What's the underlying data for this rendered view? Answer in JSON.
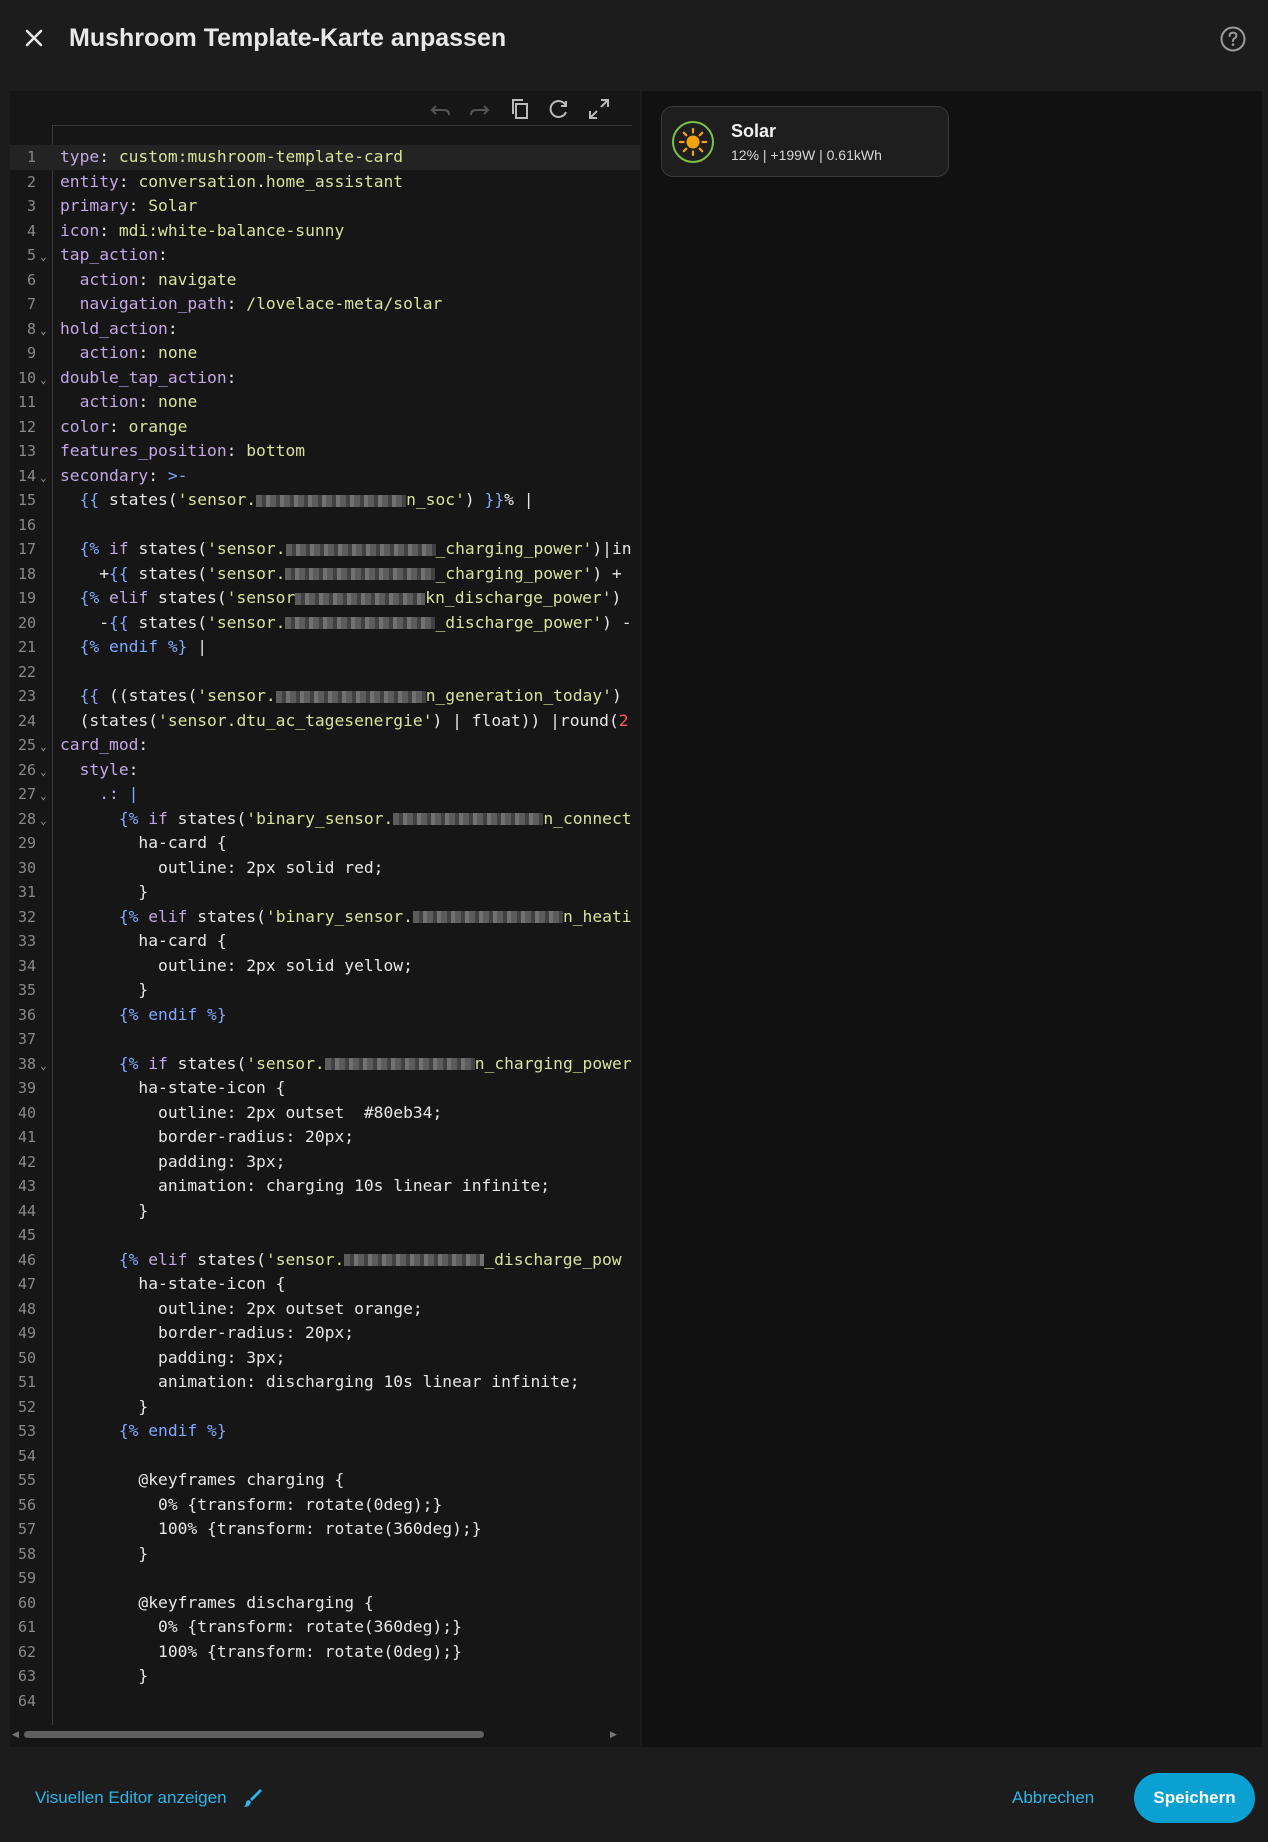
{
  "dialog": {
    "title": "Mushroom Template-Karte anpassen",
    "close_icon": "close-icon",
    "help_icon": "help-circle-icon"
  },
  "toolbar": {
    "icons": [
      "undo-icon",
      "redo-icon",
      "copy-icon",
      "refresh-icon",
      "fullscreen-icon"
    ]
  },
  "editor": {
    "lines": [
      {
        "n": "1",
        "fold": ""
      },
      {
        "n": "2",
        "fold": ""
      },
      {
        "n": "3",
        "fold": ""
      },
      {
        "n": "4",
        "fold": ""
      },
      {
        "n": "5",
        "fold": "v"
      },
      {
        "n": "6",
        "fold": ""
      },
      {
        "n": "7",
        "fold": ""
      },
      {
        "n": "8",
        "fold": "v"
      },
      {
        "n": "9",
        "fold": ""
      },
      {
        "n": "10",
        "fold": "v"
      },
      {
        "n": "11",
        "fold": ""
      },
      {
        "n": "12",
        "fold": ""
      },
      {
        "n": "13",
        "fold": ""
      },
      {
        "n": "14",
        "fold": "v"
      },
      {
        "n": "15",
        "fold": ""
      },
      {
        "n": "16",
        "fold": ""
      },
      {
        "n": "17",
        "fold": ""
      },
      {
        "n": "18",
        "fold": ""
      },
      {
        "n": "19",
        "fold": ""
      },
      {
        "n": "20",
        "fold": ""
      },
      {
        "n": "21",
        "fold": ""
      },
      {
        "n": "22",
        "fold": ""
      },
      {
        "n": "23",
        "fold": ""
      },
      {
        "n": "24",
        "fold": ""
      },
      {
        "n": "25",
        "fold": "v"
      },
      {
        "n": "26",
        "fold": "v"
      },
      {
        "n": "27",
        "fold": "v"
      },
      {
        "n": "28",
        "fold": "v"
      },
      {
        "n": "29",
        "fold": ""
      },
      {
        "n": "30",
        "fold": ""
      },
      {
        "n": "31",
        "fold": ""
      },
      {
        "n": "32",
        "fold": ""
      },
      {
        "n": "33",
        "fold": ""
      },
      {
        "n": "34",
        "fold": ""
      },
      {
        "n": "35",
        "fold": ""
      },
      {
        "n": "36",
        "fold": ""
      },
      {
        "n": "37",
        "fold": ""
      },
      {
        "n": "38",
        "fold": "v"
      },
      {
        "n": "39",
        "fold": ""
      },
      {
        "n": "40",
        "fold": ""
      },
      {
        "n": "41",
        "fold": ""
      },
      {
        "n": "42",
        "fold": ""
      },
      {
        "n": "43",
        "fold": ""
      },
      {
        "n": "44",
        "fold": ""
      },
      {
        "n": "45",
        "fold": ""
      },
      {
        "n": "46",
        "fold": ""
      },
      {
        "n": "47",
        "fold": ""
      },
      {
        "n": "48",
        "fold": ""
      },
      {
        "n": "49",
        "fold": ""
      },
      {
        "n": "50",
        "fold": ""
      },
      {
        "n": "51",
        "fold": ""
      },
      {
        "n": "52",
        "fold": ""
      },
      {
        "n": "53",
        "fold": ""
      },
      {
        "n": "54",
        "fold": ""
      },
      {
        "n": "55",
        "fold": ""
      },
      {
        "n": "56",
        "fold": ""
      },
      {
        "n": "57",
        "fold": ""
      },
      {
        "n": "58",
        "fold": ""
      },
      {
        "n": "59",
        "fold": ""
      },
      {
        "n": "60",
        "fold": ""
      },
      {
        "n": "61",
        "fold": ""
      },
      {
        "n": "62",
        "fold": ""
      },
      {
        "n": "63",
        "fold": ""
      },
      {
        "n": "64",
        "fold": ""
      }
    ],
    "code": [
      [
        [
          "k",
          "type"
        ],
        [
          "p",
          ": "
        ],
        [
          "s",
          "custom:mushroom-template-card"
        ]
      ],
      [
        [
          "k",
          "entity"
        ],
        [
          "p",
          ": "
        ],
        [
          "s",
          "conversation.home_assistant"
        ]
      ],
      [
        [
          "k",
          "primary"
        ],
        [
          "p",
          ": "
        ],
        [
          "s",
          "Solar"
        ]
      ],
      [
        [
          "k",
          "icon"
        ],
        [
          "p",
          ": "
        ],
        [
          "s",
          "mdi:white-balance-sunny"
        ]
      ],
      [
        [
          "k",
          "tap_action"
        ],
        [
          "p",
          ":"
        ]
      ],
      [
        [
          "p",
          "  "
        ],
        [
          "k",
          "action"
        ],
        [
          "p",
          ": "
        ],
        [
          "s",
          "navigate"
        ]
      ],
      [
        [
          "p",
          "  "
        ],
        [
          "k",
          "navigation_path"
        ],
        [
          "p",
          ": "
        ],
        [
          "s",
          "/lovelace-meta/solar"
        ]
      ],
      [
        [
          "k",
          "hold_action"
        ],
        [
          "p",
          ":"
        ]
      ],
      [
        [
          "p",
          "  "
        ],
        [
          "k",
          "action"
        ],
        [
          "p",
          ": "
        ],
        [
          "s",
          "none"
        ]
      ],
      [
        [
          "k",
          "double_tap_action"
        ],
        [
          "p",
          ":"
        ]
      ],
      [
        [
          "p",
          "  "
        ],
        [
          "k",
          "action"
        ],
        [
          "p",
          ": "
        ],
        [
          "s",
          "none"
        ]
      ],
      [
        [
          "k",
          "color"
        ],
        [
          "p",
          ": "
        ],
        [
          "s",
          "orange"
        ]
      ],
      [
        [
          "k",
          "features_position"
        ],
        [
          "p",
          ": "
        ],
        [
          "s",
          "bottom"
        ]
      ],
      [
        [
          "k",
          "secondary"
        ],
        [
          "p",
          ": "
        ],
        [
          "d",
          ">-"
        ]
      ],
      [
        [
          "p",
          "  "
        ],
        [
          "d",
          "{{ "
        ],
        [
          "p",
          "states("
        ],
        [
          "sq",
          "'sensor."
        ],
        [
          "b",
          "150"
        ],
        [
          "sq",
          "n_soc'"
        ],
        [
          "p",
          ") "
        ],
        [
          "d",
          "}}"
        ],
        [
          "p",
          "% |"
        ]
      ],
      [],
      [
        [
          "p",
          "  "
        ],
        [
          "d",
          "{% "
        ],
        [
          "k",
          "if "
        ],
        [
          "p",
          "states("
        ],
        [
          "sq",
          "'sensor."
        ],
        [
          "b",
          "150"
        ],
        [
          "sq",
          "_charging_power'"
        ],
        [
          "p",
          ")|in"
        ]
      ],
      [
        [
          "p",
          "    +"
        ],
        [
          "d",
          "{{ "
        ],
        [
          "p",
          "states("
        ],
        [
          "sq",
          "'sensor."
        ],
        [
          "b",
          "150"
        ],
        [
          "sq",
          "_charging_power'"
        ],
        [
          "p",
          ") +"
        ]
      ],
      [
        [
          "p",
          "  "
        ],
        [
          "d",
          "{% "
        ],
        [
          "k",
          "elif "
        ],
        [
          "p",
          "states("
        ],
        [
          "sq",
          "'sensor"
        ],
        [
          "b",
          "130"
        ],
        [
          "sq",
          "kn_discharge_power'"
        ],
        [
          "p",
          ")"
        ]
      ],
      [
        [
          "p",
          "    -"
        ],
        [
          "d",
          "{{ "
        ],
        [
          "p",
          "states("
        ],
        [
          "sq",
          "'sensor."
        ],
        [
          "b",
          "150"
        ],
        [
          "sq",
          "_discharge_power'"
        ],
        [
          "p",
          ") -"
        ]
      ],
      [
        [
          "p",
          "  "
        ],
        [
          "d",
          "{% endif %}"
        ],
        [
          "p",
          " |"
        ]
      ],
      [],
      [
        [
          "p",
          "  "
        ],
        [
          "d",
          "{{ "
        ],
        [
          "p",
          "((states("
        ],
        [
          "sq",
          "'sensor."
        ],
        [
          "b",
          "150"
        ],
        [
          "sq",
          "n_generation_today'"
        ],
        [
          "p",
          ")"
        ]
      ],
      [
        [
          "p",
          "  (states("
        ],
        [
          "sq",
          "'sensor.dtu_ac_tagesenergie'"
        ],
        [
          "p",
          ") | float)) |round("
        ],
        [
          "r",
          "2"
        ]
      ],
      [
        [
          "k",
          "card_mod"
        ],
        [
          "p",
          ":"
        ]
      ],
      [
        [
          "p",
          "  "
        ],
        [
          "k",
          "style"
        ],
        [
          "p",
          ":"
        ]
      ],
      [
        [
          "p",
          "    "
        ],
        [
          "k",
          ".:"
        ],
        [
          "p",
          " "
        ],
        [
          "d",
          "|"
        ]
      ],
      [
        [
          "p",
          "      "
        ],
        [
          "d",
          "{% "
        ],
        [
          "k",
          "if "
        ],
        [
          "p",
          "states("
        ],
        [
          "sq",
          "'binary_sensor."
        ],
        [
          "b",
          "150"
        ],
        [
          "sq",
          "n_connecti"
        ]
      ],
      [
        [
          "p",
          "        ha-card {"
        ]
      ],
      [
        [
          "p",
          "          outline: 2px solid red;"
        ]
      ],
      [
        [
          "p",
          "        }"
        ]
      ],
      [
        [
          "p",
          "      "
        ],
        [
          "d",
          "{% "
        ],
        [
          "k",
          "elif "
        ],
        [
          "p",
          "states("
        ],
        [
          "sq",
          "'binary_sensor."
        ],
        [
          "b",
          "150"
        ],
        [
          "sq",
          "n_heatin"
        ]
      ],
      [
        [
          "p",
          "        ha-card {"
        ]
      ],
      [
        [
          "p",
          "          outline: 2px solid yellow;"
        ]
      ],
      [
        [
          "p",
          "        }"
        ]
      ],
      [
        [
          "p",
          "      "
        ],
        [
          "d",
          "{% endif %}"
        ]
      ],
      [],
      [
        [
          "p",
          "      "
        ],
        [
          "d",
          "{% "
        ],
        [
          "k",
          "if "
        ],
        [
          "p",
          "states("
        ],
        [
          "sq",
          "'sensor."
        ],
        [
          "b",
          "150"
        ],
        [
          "sq",
          "n_charging_power"
        ]
      ],
      [
        [
          "p",
          "        ha-state-icon {"
        ]
      ],
      [
        [
          "p",
          "          outline: 2px outset  #80eb34;"
        ]
      ],
      [
        [
          "p",
          "          border-radius: 20px;"
        ]
      ],
      [
        [
          "p",
          "          padding: 3px;"
        ]
      ],
      [
        [
          "p",
          "          animation: charging 10s linear infinite;"
        ]
      ],
      [
        [
          "p",
          "        }"
        ]
      ],
      [],
      [
        [
          "p",
          "      "
        ],
        [
          "d",
          "{% "
        ],
        [
          "k",
          "elif "
        ],
        [
          "p",
          "states("
        ],
        [
          "sq",
          "'sensor."
        ],
        [
          "b",
          "140"
        ],
        [
          "sq",
          "_discharge_pow"
        ]
      ],
      [
        [
          "p",
          "        ha-state-icon {"
        ]
      ],
      [
        [
          "p",
          "          outline: 2px outset orange;"
        ]
      ],
      [
        [
          "p",
          "          border-radius: 20px;"
        ]
      ],
      [
        [
          "p",
          "          padding: 3px;"
        ]
      ],
      [
        [
          "p",
          "          animation: discharging 10s linear infinite;"
        ]
      ],
      [
        [
          "p",
          "        }"
        ]
      ],
      [
        [
          "p",
          "      "
        ],
        [
          "d",
          "{% endif %}"
        ]
      ],
      [],
      [
        [
          "p",
          "        @keyframes charging {"
        ]
      ],
      [
        [
          "p",
          "          0% {transform: rotate(0deg);}"
        ]
      ],
      [
        [
          "p",
          "          100% {transform: rotate(360deg);}"
        ]
      ],
      [
        [
          "p",
          "        }"
        ]
      ],
      [],
      [
        [
          "p",
          "        @keyframes discharging {"
        ]
      ],
      [
        [
          "p",
          "          0% {transform: rotate(360deg);}"
        ]
      ],
      [
        [
          "p",
          "          100% {transform: rotate(0deg);}"
        ]
      ],
      [
        [
          "p",
          "        }"
        ]
      ],
      []
    ]
  },
  "preview": {
    "card": {
      "primary": "Solar",
      "secondary": "12% | +199W | 0.61kWh",
      "icon": "white-balance-sunny-icon",
      "icon_color": "#f5a20a",
      "ring_color": "#7bc142"
    }
  },
  "footer": {
    "visual_editor_label": "Visuellen Editor anzeigen",
    "pencil_icon": "brush-icon",
    "cancel_label": "Abbrechen",
    "save_label": "Speichern"
  },
  "colors": {
    "accent": "#0aa0d2",
    "link": "#2bb5e8",
    "background": "#1c1c1c"
  }
}
